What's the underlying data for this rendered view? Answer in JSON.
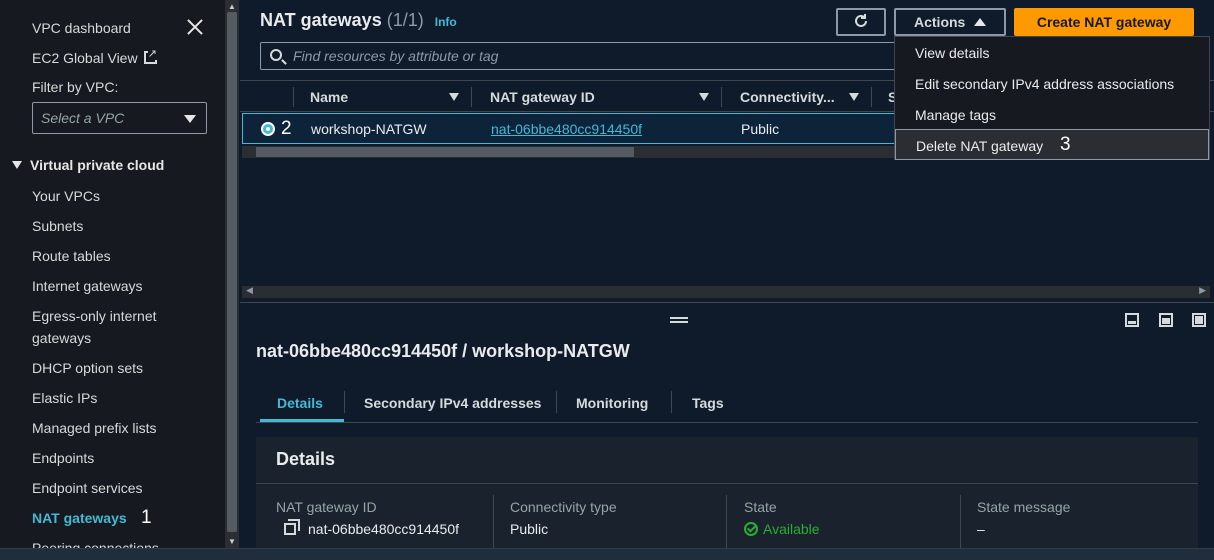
{
  "sidebar": {
    "vpc_dashboard": "VPC dashboard",
    "ec2_global_view": "EC2 Global View",
    "filter_label": "Filter by VPC:",
    "select_placeholder": "Select a VPC",
    "section": "Virtual private cloud",
    "items": [
      "Your VPCs",
      "Subnets",
      "Route tables",
      "Internet gateways",
      "Egress-only internet",
      "gateways",
      "DHCP option sets",
      "Elastic IPs",
      "Managed prefix lists",
      "Endpoints",
      "Endpoint services",
      "NAT gateways",
      "Peering connections"
    ]
  },
  "steps": {
    "one": "1",
    "two": "2",
    "three": "3"
  },
  "header": {
    "title": "NAT gateways",
    "count": "(1/1)",
    "info": "Info",
    "actions_label": "Actions",
    "create_label": "Create NAT gateway",
    "search_placeholder": "Find resources by attribute or tag"
  },
  "table": {
    "columns": [
      "Name",
      "NAT gateway ID",
      "Connectivity...",
      "S"
    ],
    "rows": [
      {
        "name": "workshop-NATGW",
        "id": "nat-06bbe480cc914450f",
        "connectivity": "Public"
      }
    ]
  },
  "actions_menu": {
    "items": [
      "View details",
      "Edit secondary IPv4 address associations",
      "Manage tags",
      "Delete NAT gateway"
    ]
  },
  "details": {
    "title": "nat-06bbe480cc914450f / workshop-NATGW",
    "tabs": [
      "Details",
      "Secondary IPv4 addresses",
      "Monitoring",
      "Tags"
    ],
    "card_title": "Details",
    "fields": [
      {
        "label": "NAT gateway ID",
        "value": "nat-06bbe480cc914450f"
      },
      {
        "label": "Connectivity type",
        "value": "Public"
      },
      {
        "label": "State",
        "value": "Available"
      },
      {
        "label": "State message",
        "value": "–"
      }
    ]
  },
  "colors": {
    "accent": "#44b9d6",
    "primary_button": "#ff9900",
    "success": "#29ad32"
  }
}
